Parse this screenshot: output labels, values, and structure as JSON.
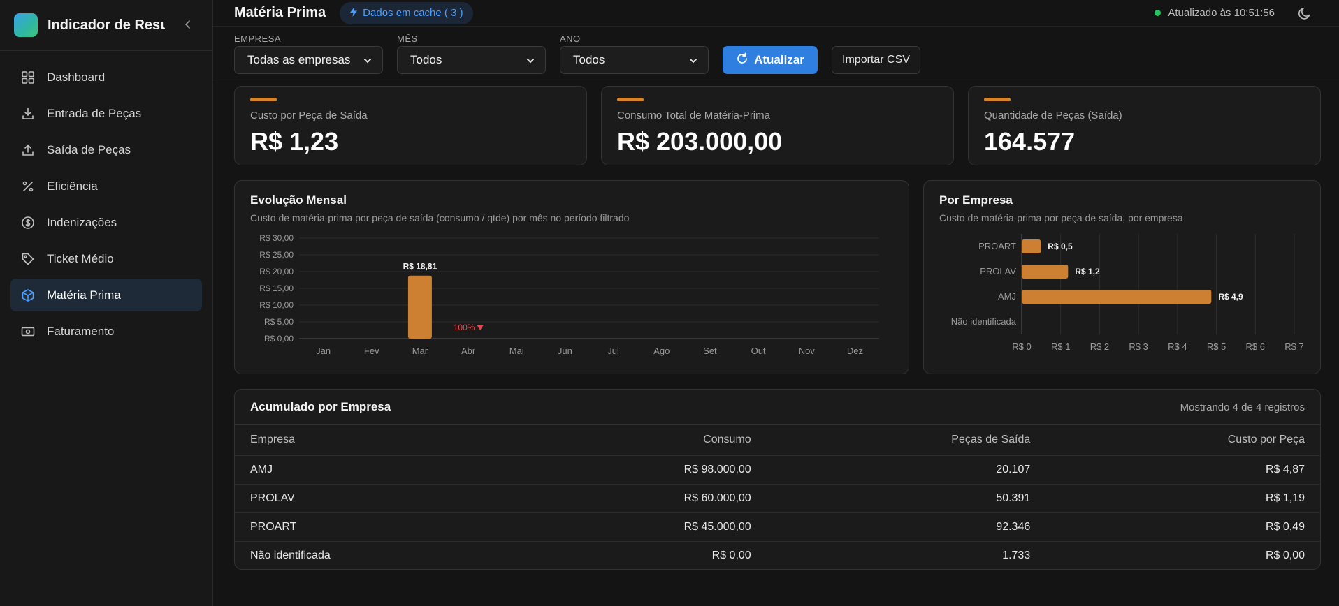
{
  "sidebar": {
    "app_title": "Indicador de Resultados",
    "items": [
      {
        "label": "Dashboard",
        "icon": "grid-icon",
        "active": false
      },
      {
        "label": "Entrada de Peças",
        "icon": "download-icon",
        "active": false
      },
      {
        "label": "Saída de Peças",
        "icon": "upload-icon",
        "active": false
      },
      {
        "label": "Eficiência",
        "icon": "percent-icon",
        "active": false
      },
      {
        "label": "Indenizações",
        "icon": "coin-icon",
        "active": false
      },
      {
        "label": "Ticket Médio",
        "icon": "tag-icon",
        "active": false
      },
      {
        "label": "Matéria Prima",
        "icon": "box-icon",
        "active": true
      },
      {
        "label": "Faturamento",
        "icon": "banknote-icon",
        "active": false
      }
    ]
  },
  "header": {
    "title": "Matéria Prima",
    "cache_label": "Dados em cache ( 3 )",
    "updated_label": "Atualizado às 10:51:56"
  },
  "filters": {
    "empresa": {
      "label": "EMPRESA",
      "value": "Todas as empresas"
    },
    "mes": {
      "label": "MÊS",
      "value": "Todos"
    },
    "ano": {
      "label": "ANO",
      "value": "Todos"
    },
    "refresh_label": "Atualizar",
    "import_label": "Importar CSV"
  },
  "kpis": [
    {
      "label": "Custo por Peça de Saída",
      "value": "R$ 1,23"
    },
    {
      "label": "Consumo Total de Matéria-Prima",
      "value": "R$ 203.000,00"
    },
    {
      "label": "Quantidade de Peças (Saída)",
      "value": "164.577"
    }
  ],
  "monthly_chart": {
    "title": "Evolução Mensal",
    "subtitle": "Custo de matéria-prima por peça de saída (consumo / qtde) por mês no período filtrado"
  },
  "company_chart": {
    "title": "Por Empresa",
    "subtitle": "Custo de matéria-prima por peça de saída, por empresa"
  },
  "chart_data": [
    {
      "type": "bar",
      "title": "Evolução Mensal",
      "categories": [
        "Jan",
        "Fev",
        "Mar",
        "Abr",
        "Mai",
        "Jun",
        "Jul",
        "Ago",
        "Set",
        "Out",
        "Nov",
        "Dez"
      ],
      "values": [
        null,
        null,
        18.81,
        null,
        null,
        null,
        null,
        null,
        null,
        null,
        null,
        null
      ],
      "data_labels": {
        "Mar": "R$ 18,81"
      },
      "annotation": {
        "category": "Abr",
        "text": "100%",
        "direction": "down",
        "color": "#e5484d"
      },
      "yticks": [
        "R$ 0,00",
        "R$ 5,00",
        "R$ 10,00",
        "R$ 15,00",
        "R$ 20,00",
        "R$ 25,00",
        "R$ 30,00"
      ],
      "ylim": [
        0,
        30
      ],
      "grid": true,
      "bar_color": "#cd7f32"
    },
    {
      "type": "bar",
      "orientation": "horizontal",
      "title": "Por Empresa",
      "categories": [
        "PROART",
        "PROLAV",
        "AMJ",
        "Não identificada"
      ],
      "values": [
        0.49,
        1.19,
        4.87,
        0
      ],
      "data_labels": [
        "R$ 0,5",
        "R$ 1,2",
        "R$ 4,9",
        ""
      ],
      "xticks": [
        "R$ 0",
        "R$ 1",
        "R$ 2",
        "R$ 3",
        "R$ 4",
        "R$ 5",
        "R$ 6",
        "R$ 7"
      ],
      "xlim": [
        0,
        7
      ],
      "grid": true,
      "bar_color": "#cd7f32"
    }
  ],
  "table": {
    "title": "Acumulado por Empresa",
    "count_label": "Mostrando 4 de 4 registros",
    "columns": [
      "Empresa",
      "Consumo",
      "Peças de Saída",
      "Custo por Peça"
    ],
    "rows": [
      [
        "AMJ",
        "R$ 98.000,00",
        "20.107",
        "R$ 4,87"
      ],
      [
        "PROLAV",
        "R$ 60.000,00",
        "50.391",
        "R$ 1,19"
      ],
      [
        "PROART",
        "R$ 45.000,00",
        "92.346",
        "R$ 0,49"
      ],
      [
        "Não identificada",
        "R$ 0,00",
        "1.733",
        "R$ 0,00"
      ]
    ]
  },
  "colors": {
    "accent": "#2f7fe0",
    "bar": "#cd7f32",
    "status_green": "#22c55e",
    "decline_red": "#e5484d"
  }
}
